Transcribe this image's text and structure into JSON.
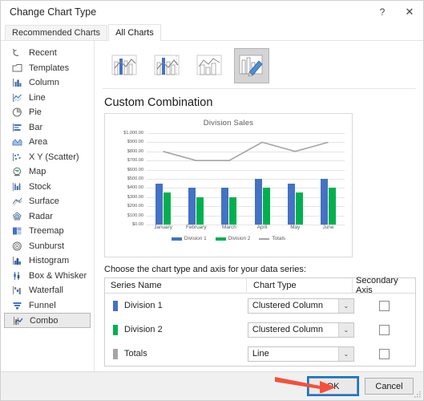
{
  "window": {
    "title": "Change Chart Type",
    "help_label": "?",
    "close_label": "✕"
  },
  "tabs": [
    {
      "label": "Recommended Charts",
      "active": false
    },
    {
      "label": "All Charts",
      "active": true
    }
  ],
  "sidebar": {
    "items": [
      {
        "label": "Recent",
        "icon": "recent-icon",
        "selected": false
      },
      {
        "label": "Templates",
        "icon": "templates-icon",
        "selected": false
      },
      {
        "label": "Column",
        "icon": "column-icon",
        "selected": false
      },
      {
        "label": "Line",
        "icon": "line-icon",
        "selected": false
      },
      {
        "label": "Pie",
        "icon": "pie-icon",
        "selected": false
      },
      {
        "label": "Bar",
        "icon": "bar-icon",
        "selected": false
      },
      {
        "label": "Area",
        "icon": "area-icon",
        "selected": false
      },
      {
        "label": "X Y (Scatter)",
        "icon": "scatter-icon",
        "selected": false
      },
      {
        "label": "Map",
        "icon": "map-icon",
        "selected": false
      },
      {
        "label": "Stock",
        "icon": "stock-icon",
        "selected": false
      },
      {
        "label": "Surface",
        "icon": "surface-icon",
        "selected": false
      },
      {
        "label": "Radar",
        "icon": "radar-icon",
        "selected": false
      },
      {
        "label": "Treemap",
        "icon": "treemap-icon",
        "selected": false
      },
      {
        "label": "Sunburst",
        "icon": "sunburst-icon",
        "selected": false
      },
      {
        "label": "Histogram",
        "icon": "histogram-icon",
        "selected": false
      },
      {
        "label": "Box & Whisker",
        "icon": "box-whisker-icon",
        "selected": false
      },
      {
        "label": "Waterfall",
        "icon": "waterfall-icon",
        "selected": false
      },
      {
        "label": "Funnel",
        "icon": "funnel-icon",
        "selected": false
      },
      {
        "label": "Combo",
        "icon": "combo-icon",
        "selected": true
      }
    ]
  },
  "thumbnails": [
    {
      "name": "clustered-column-line",
      "selected": false
    },
    {
      "name": "clustered-column-line-secondary-axis",
      "selected": false
    },
    {
      "name": "stacked-area-clustered-column",
      "selected": false
    },
    {
      "name": "custom-combination",
      "selected": true
    }
  ],
  "preview": {
    "heading": "Custom Combination"
  },
  "chart_data": {
    "type": "bar",
    "title": "Division Sales",
    "xlabel": "",
    "ylabel": "",
    "categories": [
      "January",
      "February",
      "March",
      "April",
      "May",
      "June"
    ],
    "series": [
      {
        "name": "Division 1",
        "type": "column",
        "color": "#4472C4",
        "values": [
          450,
          400,
          400,
          500,
          450,
          500
        ]
      },
      {
        "name": "Division 2",
        "type": "column",
        "color": "#00B050",
        "values": [
          350,
          300,
          300,
          400,
          350,
          400
        ]
      },
      {
        "name": "Totals",
        "type": "line",
        "color": "#A5A5A5",
        "values": [
          800,
          700,
          700,
          900,
          800,
          900
        ]
      }
    ],
    "ylim": [
      0,
      1000
    ],
    "ytick_values": [
      0,
      100,
      200,
      300,
      400,
      500,
      600,
      700,
      800,
      900,
      1000
    ],
    "ytick_labels": [
      "$0.00",
      "$100.00",
      "$200.00",
      "$300.00",
      "$400.00",
      "$500.00",
      "$600.00",
      "$700.00",
      "$800.00",
      "$900.00",
      "$1,000.00"
    ],
    "grid": true,
    "legend_position": "bottom",
    "legend": [
      "Division 1",
      "Division 2",
      "Totals"
    ]
  },
  "series_section": {
    "instruction": "Choose the chart type and axis for your data series:",
    "columns": [
      "Series Name",
      "Chart Type",
      "Secondary Axis"
    ],
    "rows": [
      {
        "name": "Division 1",
        "swatch": "#4472C4",
        "chart_type": "Clustered Column",
        "secondary_axis": false
      },
      {
        "name": "Division 2",
        "swatch": "#00B050",
        "chart_type": "Clustered Column",
        "secondary_axis": false
      },
      {
        "name": "Totals",
        "swatch": "#A5A5A5",
        "chart_type": "Line",
        "secondary_axis": false
      }
    ],
    "dropdown_arrow": "⌄"
  },
  "footer": {
    "ok_label": "OK",
    "cancel_label": "Cancel"
  },
  "annotation": {
    "arrow_color": "#F4513C",
    "points_to": "OK"
  }
}
